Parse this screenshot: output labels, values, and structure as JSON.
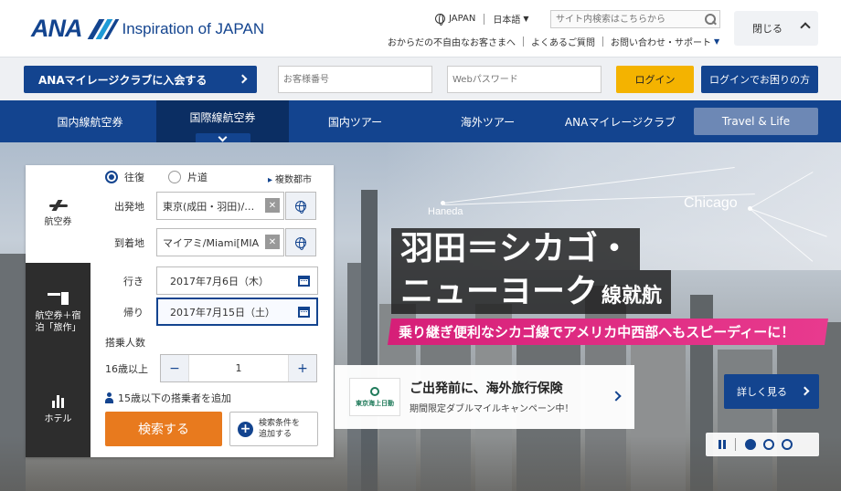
{
  "header": {
    "logo_text": "ANA",
    "tagline": "Inspiration of JAPAN",
    "region": "JAPAN",
    "language": "日本語",
    "search_placeholder": "サイト内検索はこちらから",
    "links": [
      "おからだの不自由なお客さまへ",
      "よくあるご質問",
      "お問い合わせ・サポート"
    ],
    "close_label": "閉じる"
  },
  "login_bar": {
    "amc_join": "ANAマイレージクラブに入会する",
    "customer_no_placeholder": "お客様番号",
    "password_placeholder": "Webパスワード",
    "login_label": "ログイン",
    "login_help_label": "ログインでお困りの方"
  },
  "nav": {
    "items": [
      "国内線航空券",
      "国際線航空券",
      "国内ツアー",
      "海外ツアー",
      "ANAマイレージクラブ",
      "Travel & Life"
    ],
    "active_index": 1
  },
  "hero": {
    "map_labels": [
      "Haneda",
      "Chicago"
    ],
    "headline_1": "羽田＝シカゴ・",
    "headline_2": "ニューヨーク",
    "headline_2_suffix": "線就航",
    "tagline": "乗り継ぎ便利なシカゴ線でアメリカ中西部へもスピーディーに！",
    "promo": {
      "logo_text": "東京海上日動",
      "title": "ご出発前に、海外旅行保険",
      "subtitle": "期間限定ダブルマイルキャンペーン中！"
    },
    "detail_label": "詳しく見る",
    "slides_total": 3,
    "slide_active": 1
  },
  "search_widget": {
    "tabs": [
      {
        "label": "航空券",
        "icon": "plane-icon"
      },
      {
        "label": "航空券＋宿泊「旅作」",
        "icon": "plane-hotel-icon"
      },
      {
        "label": "ホテル",
        "icon": "hotel-icon"
      }
    ],
    "active_tab": 0,
    "trip_types": [
      "往復",
      "片道"
    ],
    "trip_selected": "往復",
    "multi_city": "複数都市",
    "origin_label": "出発地",
    "origin_value": "東京(成田・羽田)/…",
    "destination_label": "到着地",
    "destination_value": "マイアミ/Miami[MIA",
    "outbound_label": "行き",
    "outbound_date": "2017年7月6日（木）",
    "return_label": "帰り",
    "return_date": "2017年7月15日（土）",
    "passengers_title": "搭乗人数",
    "adult_label": "16歳以上",
    "adult_count": "1",
    "add_child": "15歳以下の搭乗者を追加",
    "search_label": "検索する",
    "more_conditions_1": "検索条件を",
    "more_conditions_2": "追加する",
    "clear_symbol": "✕",
    "minus": "−",
    "plus": "+"
  },
  "colors": {
    "brand_blue": "#13448f",
    "accent_orange": "#e87a1e",
    "login_yellow": "#f4b300",
    "promo_pink": "#d61f78"
  }
}
